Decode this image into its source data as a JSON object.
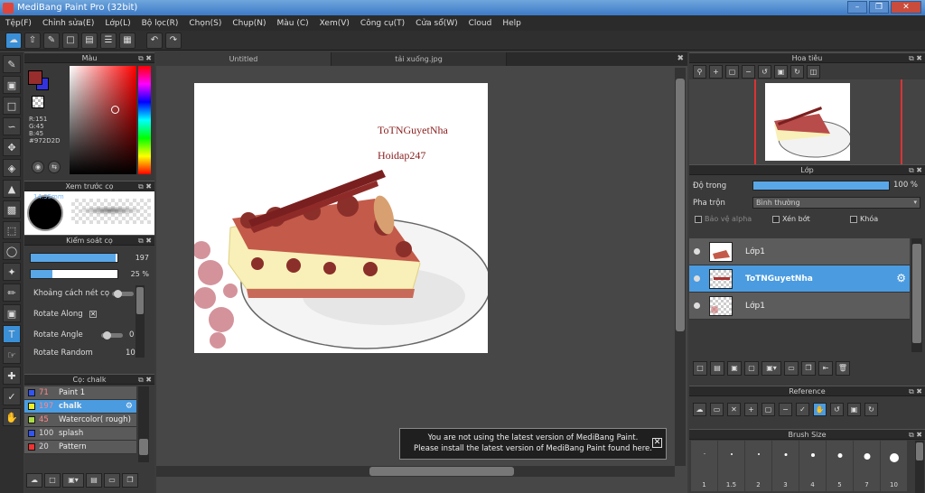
{
  "window": {
    "title": "MediBang Paint Pro (32bit)"
  },
  "menu": [
    "Tệp(F)",
    "Chỉnh sửa(E)",
    "Lớp(L)",
    "Bộ lọc(R)",
    "Chọn(S)",
    "Chụp(N)",
    "Màu (C)",
    "Xem(V)",
    "Công cụ(T)",
    "Cửa sổ(W)",
    "Cloud",
    "Help"
  ],
  "panels": {
    "color": "Màu",
    "brush_preview": "Xem trước cọ",
    "brush_control": "Kiểm soát cọ",
    "brush_list": "Cọ: chalk",
    "navigator": "Hoa tiêu",
    "layer": "Lớp",
    "reference": "Reference",
    "brush_size": "Brush Size"
  },
  "color": {
    "main": "#972D2D",
    "r": "R:151",
    "g": "G:45",
    "b": "B:45",
    "hex": "#972D2D"
  },
  "brush_preview": {
    "size": "14.35mm"
  },
  "brush_control": {
    "size_value": "197",
    "size_fraction": 0.98,
    "opacity_value": "25 %",
    "opacity_fraction": 0.25,
    "spacing_label": "Khoảng cách nét cọ",
    "rotate_along_label": "Rotate Along",
    "rotate_angle_label": "Rotate Angle",
    "rotate_angle_value": "0",
    "rotate_random_label": "Rotate Random",
    "rotate_random_value": "10"
  },
  "brushes": [
    {
      "num": "71",
      "name": "Paint 1",
      "color": "#3355ee"
    },
    {
      "num": "197",
      "name": "chalk",
      "color": "#eeee22"
    },
    {
      "num": "45",
      "name": "Watercolor( rough)",
      "color": "#aadd44"
    },
    {
      "num": "100",
      "name": "splash",
      "color": "#3355ee"
    },
    {
      "num": "20",
      "name": "Pattern",
      "color": "#ee3333"
    }
  ],
  "tabs": [
    "Untitled",
    "tải xuống.jpg"
  ],
  "canvas_text": {
    "line1": "ToTNGuyetNha",
    "line2": "Hoidap247"
  },
  "notice": {
    "line1": "You are not using the latest version of MediBang Paint.",
    "line2": "Please install the latest version of MediBang Paint found here."
  },
  "layer_props": {
    "opacity_label": "Độ trong",
    "opacity_value": "100 %",
    "blend_label": "Pha trộn",
    "blend_value": "Bình thường",
    "protect_alpha": "Bảo vệ alpha",
    "clipping": "Xén bớt",
    "lock": "Khóa"
  },
  "layers": [
    {
      "name": "Lớp1"
    },
    {
      "name": "ToTNGuyetNha"
    },
    {
      "name": "Lớp1"
    }
  ],
  "brush_sizes": [
    "1",
    "1.5",
    "2",
    "3",
    "4",
    "5",
    "7",
    "10"
  ],
  "colors": {
    "accent": "#4a9be0",
    "title_bar": "#3d7ac6",
    "background": "#3c3c3c"
  }
}
